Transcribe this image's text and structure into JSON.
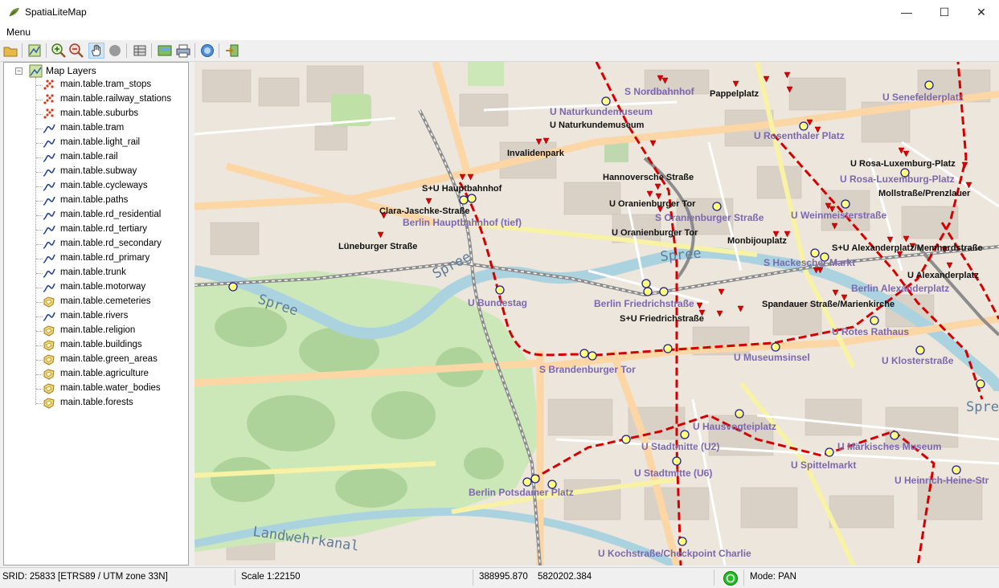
{
  "window": {
    "title": "SpatiaLiteMap",
    "minimize": "—",
    "maximize": "☐",
    "close": "✕"
  },
  "menu": {
    "label": "Menu"
  },
  "toolbar": {
    "buttons": [
      "open-icon",
      "layer-properties-icon",
      "zoom-in-icon",
      "zoom-out-icon",
      "pan-hand-icon",
      "stop-icon",
      "table-icon",
      "export-image-icon",
      "print-icon",
      "help-icon",
      "exit-icon"
    ]
  },
  "tree": {
    "root_label": "Map Layers",
    "expander": "−",
    "layers": [
      {
        "label": "main.table.tram_stops",
        "kind": "point"
      },
      {
        "label": "main.table.railway_stations",
        "kind": "point"
      },
      {
        "label": "main.table.suburbs",
        "kind": "point"
      },
      {
        "label": "main.table.tram",
        "kind": "line"
      },
      {
        "label": "main.table.light_rail",
        "kind": "line"
      },
      {
        "label": "main.table.rail",
        "kind": "line"
      },
      {
        "label": "main.table.subway",
        "kind": "line"
      },
      {
        "label": "main.table.cycleways",
        "kind": "line"
      },
      {
        "label": "main.table.paths",
        "kind": "line"
      },
      {
        "label": "main.table.rd_residential",
        "kind": "line"
      },
      {
        "label": "main.table.rd_tertiary",
        "kind": "line"
      },
      {
        "label": "main.table.rd_secondary",
        "kind": "line"
      },
      {
        "label": "main.table.rd_primary",
        "kind": "line"
      },
      {
        "label": "main.table.trunk",
        "kind": "line"
      },
      {
        "label": "main.table.motorway",
        "kind": "line"
      },
      {
        "label": "main.table.cemeteries",
        "kind": "polygon"
      },
      {
        "label": "main.table.rivers",
        "kind": "line"
      },
      {
        "label": "main.table.religion",
        "kind": "polygon"
      },
      {
        "label": "main.table.buildings",
        "kind": "polygon"
      },
      {
        "label": "main.table.green_areas",
        "kind": "polygon"
      },
      {
        "label": "main.table.agriculture",
        "kind": "polygon"
      },
      {
        "label": "main.table.water_bodies",
        "kind": "polygon"
      },
      {
        "label": "main.table.forests",
        "kind": "polygon"
      }
    ]
  },
  "map": {
    "stations": [
      "S Nordbahnhof",
      "U Naturkundemuseum",
      "U Senefelderplatz",
      "U Rosenthaler Platz",
      "U Rosa-Luxemburg-Platz",
      "Berlin Hauptbahnhof (tief)",
      "S Oranienburger Straße",
      "U Weinmeisterstraße",
      "S Hackescher Markt",
      "Berlin Alexanderplatz",
      "U Bundestag",
      "Berlin Friedrichstraße",
      "U Rotes Rathaus",
      "U Museumsinsel",
      "U Klosterstraße",
      "S Brandenburger Tor",
      "U Hausvogteiplatz",
      "U Stadtmitte (U2)",
      "U Märkisches Museum",
      "U Spittelmarkt",
      "U Stadtmitte (U6)",
      "U Heinrich-Heine-Str",
      "Berlin Potsdamer Platz",
      "U Kochstraße/Checkpoint Charlie"
    ],
    "stops": [
      "Pappelplatz",
      "U Naturkundemuseum",
      "Invalidenpark",
      "Hannoversche Straße",
      "S+U Hauptbahnhof",
      "Clara-Jaschke-Straße",
      "U Oranienburger Tor",
      "U Oranienburger Tor",
      "Lüneburger Straße",
      "Monbijouplatz",
      "U Rosa-Luxemburg-Platz",
      "Mollstraße/Prenzlauer",
      "S+U Alexanderplatz/Memhardstraße",
      "U Alexanderplatz",
      "Spandauer Straße/Marienkirche",
      "S+U Friedrichstraße"
    ],
    "rivers": [
      "Spree",
      "Spree",
      "Spree",
      "Spree",
      "Landwehrkanal"
    ]
  },
  "status": {
    "srid": "SRID: 25833 [ETRS89 / UTM zone 33N]",
    "scale": "Scale 1:22150",
    "x": "388995.870",
    "y": "5820202.384",
    "mode": "Mode: PAN"
  },
  "colors": {
    "station_label": "#7b68b0",
    "subway": "#d40000",
    "tram_stop": "#e00000",
    "green": "#cde8b8",
    "water": "#aad3df"
  }
}
